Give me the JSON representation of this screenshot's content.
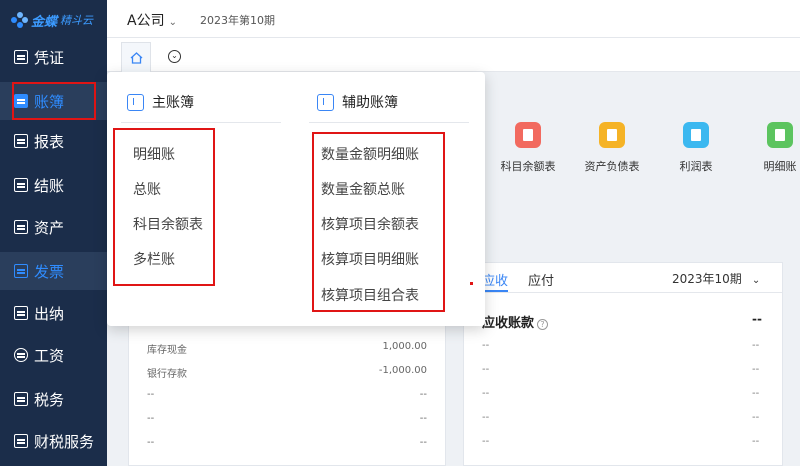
{
  "app": {
    "logo_brand": "金蝶",
    "logo_product": "精斗云"
  },
  "header": {
    "company": "A公司",
    "period": "2023年第10期"
  },
  "sidebar": {
    "items": [
      {
        "label": "凭证"
      },
      {
        "label": "账簿"
      },
      {
        "label": "报表"
      },
      {
        "label": "结账"
      },
      {
        "label": "资产"
      },
      {
        "label": "发票"
      },
      {
        "label": "出纳"
      },
      {
        "label": "工资"
      },
      {
        "label": "税务"
      },
      {
        "label": "财税服务"
      }
    ]
  },
  "dropdown": {
    "main_ledger": {
      "title": "主账簿",
      "items": [
        "明细账",
        "总账",
        "科目余额表",
        "多栏账"
      ]
    },
    "aux_ledger": {
      "title": "辅助账簿",
      "items": [
        "数量金额明细账",
        "数量金额总账",
        "核算项目余额表",
        "核算项目明细账",
        "核算项目组合表"
      ]
    }
  },
  "shortcuts": [
    {
      "label": "科目余额表",
      "color": "#f26a5f"
    },
    {
      "label": "资产负债表",
      "color": "#f5b326"
    },
    {
      "label": "利润表",
      "color": "#3bb8f0"
    },
    {
      "label": "明细账",
      "color": "#5cc45f"
    }
  ],
  "cash_panel": {
    "rows": [
      {
        "name": "库存现金",
        "value": "1,000.00"
      },
      {
        "name": "银行存款",
        "value": "-1,000.00"
      },
      {
        "name": "--",
        "value": "--"
      },
      {
        "name": "--",
        "value": "--"
      },
      {
        "name": "--",
        "value": "--"
      }
    ]
  },
  "receivables": {
    "tab_receivable": "应收",
    "tab_payable": "应付",
    "period": "2023年10期",
    "title": "应收账款",
    "total": "--",
    "rows": [
      {
        "name": "--",
        "value": "--"
      },
      {
        "name": "--",
        "value": "--"
      },
      {
        "name": "--",
        "value": "--"
      },
      {
        "name": "--",
        "value": "--"
      },
      {
        "name": "--",
        "value": "--"
      }
    ]
  }
}
